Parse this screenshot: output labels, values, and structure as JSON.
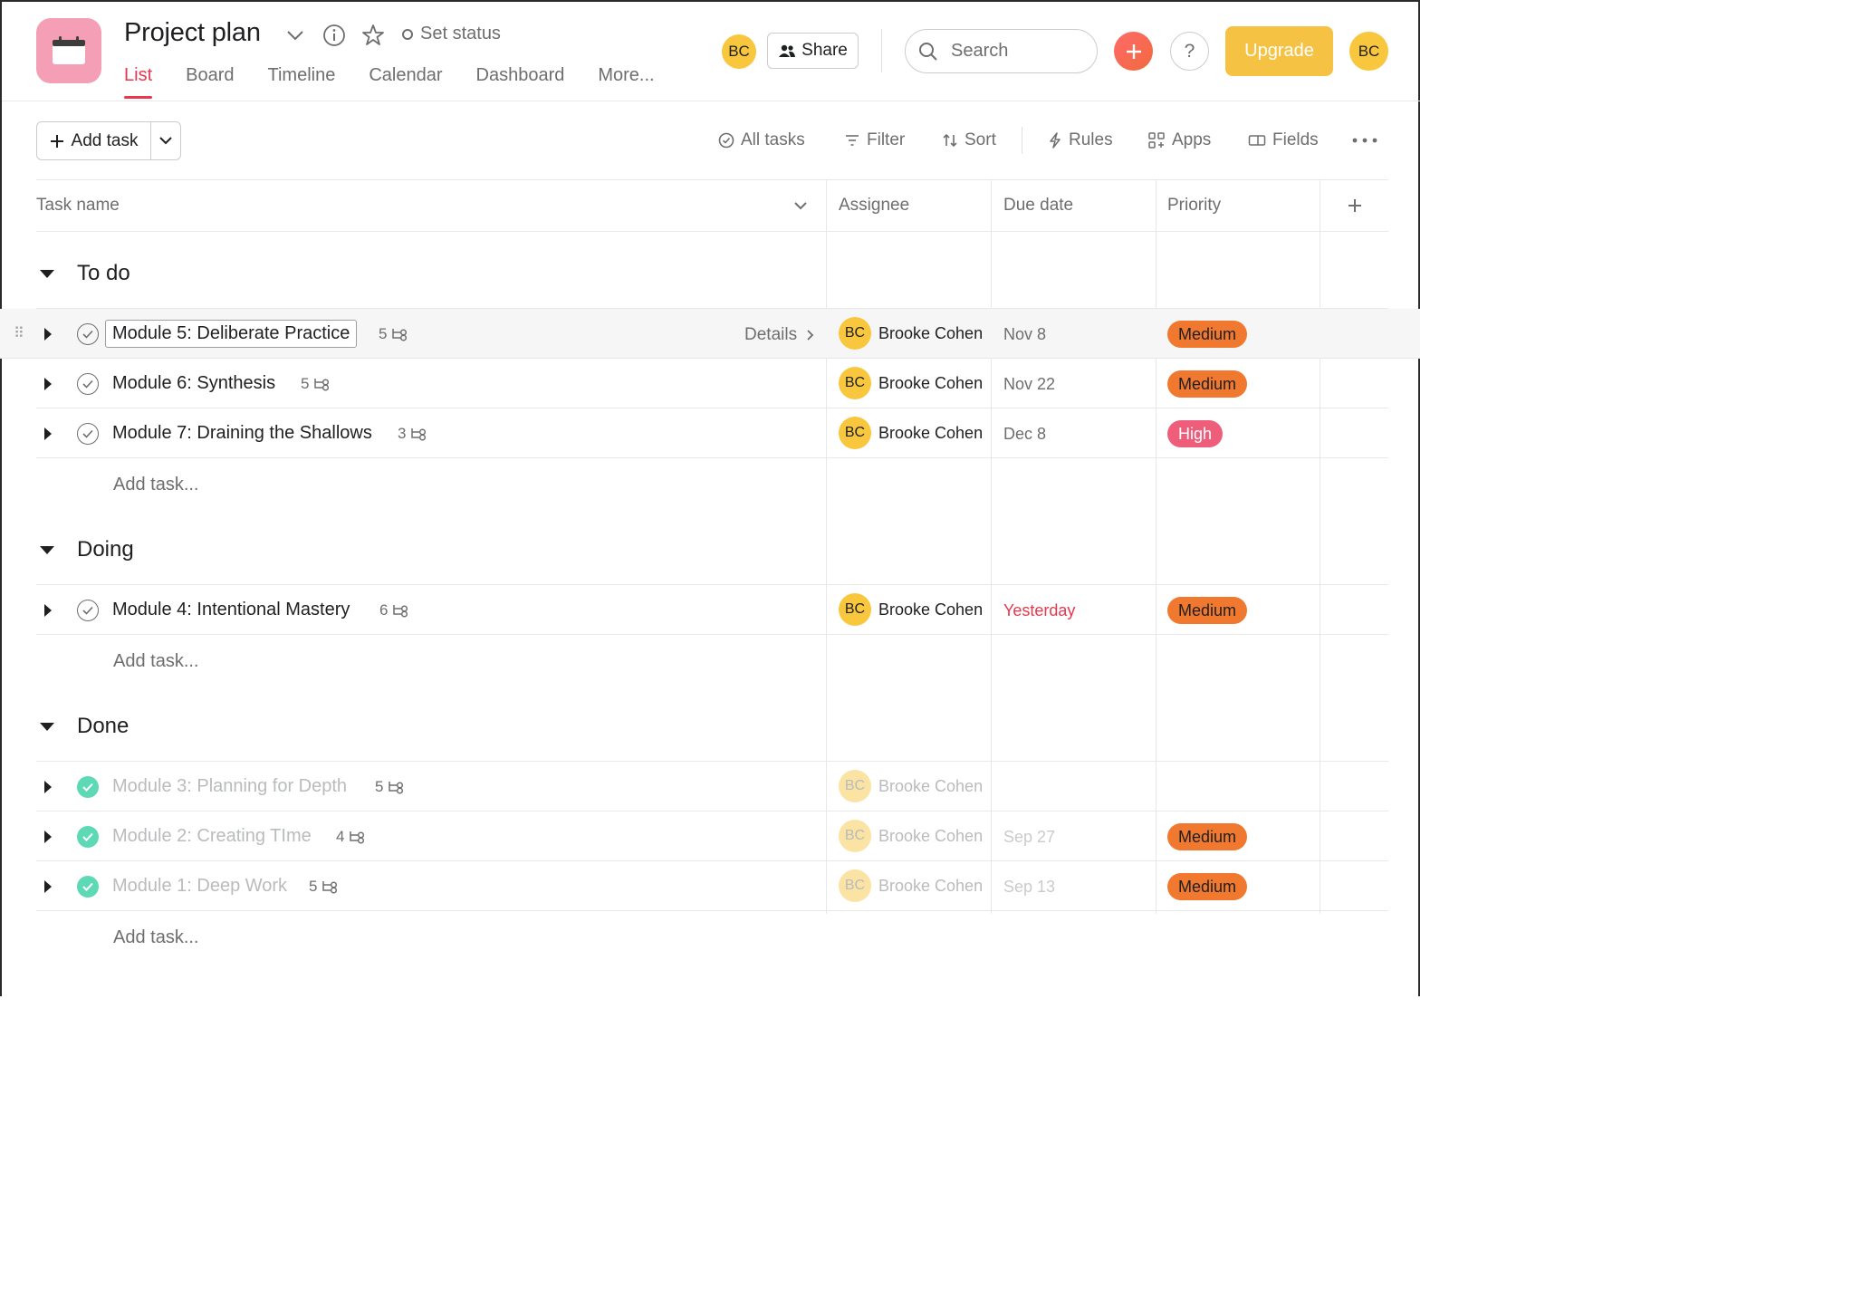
{
  "project": {
    "title": "Project plan",
    "set_status_label": "Set status",
    "icon": "calendar-icon"
  },
  "tabs": [
    "List",
    "Board",
    "Timeline",
    "Calendar",
    "Dashboard",
    "More..."
  ],
  "header": {
    "member_avatar": "BC",
    "share_label": "Share",
    "search_placeholder": "Search",
    "upgrade_label": "Upgrade",
    "user_avatar": "BC",
    "help_label": "?"
  },
  "toolbar": {
    "add_task_label": "Add task",
    "all_tasks_label": "All tasks",
    "filter_label": "Filter",
    "sort_label": "Sort",
    "rules_label": "Rules",
    "apps_label": "Apps",
    "fields_label": "Fields"
  },
  "columns": {
    "task_name": "Task name",
    "assignee": "Assignee",
    "due_date": "Due date",
    "priority": "Priority"
  },
  "add_task_link": "Add task...",
  "details_label": "Details",
  "sections": [
    {
      "title": "To do",
      "tasks": [
        {
          "name": "Module 5: Deliberate Practice",
          "subtasks": "5",
          "assignee": "Brooke Cohen",
          "initials": "BC",
          "due": "Nov 8",
          "priority": "Medium"
        },
        {
          "name": "Module 6: Synthesis",
          "subtasks": "5",
          "assignee": "Brooke Cohen",
          "initials": "BC",
          "due": "Nov 22",
          "priority": "Medium"
        },
        {
          "name": "Module 7: Draining the Shallows",
          "subtasks": "3",
          "assignee": "Brooke Cohen",
          "initials": "BC",
          "due": "Dec 8",
          "priority": "High"
        }
      ]
    },
    {
      "title": "Doing",
      "tasks": [
        {
          "name": "Module 4: Intentional Mastery",
          "subtasks": "6",
          "assignee": "Brooke Cohen",
          "initials": "BC",
          "due": "Yesterday",
          "priority": "Medium"
        }
      ]
    },
    {
      "title": "Done",
      "tasks": [
        {
          "name": "Module 3: Planning for Depth",
          "subtasks": "5",
          "assignee": "Brooke Cohen",
          "initials": "BC",
          "due": "",
          "priority": ""
        },
        {
          "name": "Module 2: Creating TIme",
          "subtasks": "4",
          "assignee": "Brooke Cohen",
          "initials": "BC",
          "due": "Sep 27",
          "priority": "Medium"
        },
        {
          "name": "Module 1: Deep Work",
          "subtasks": "5",
          "assignee": "Brooke Cohen",
          "initials": "BC",
          "due": "Sep 13",
          "priority": "Medium"
        }
      ]
    }
  ],
  "colors": {
    "accent": "#e8384f",
    "medium": "#f0782f",
    "high": "#ee5e7a",
    "done_check": "#5ed9b5",
    "avatar": "#f8c73e",
    "upgrade": "#f5c243"
  }
}
